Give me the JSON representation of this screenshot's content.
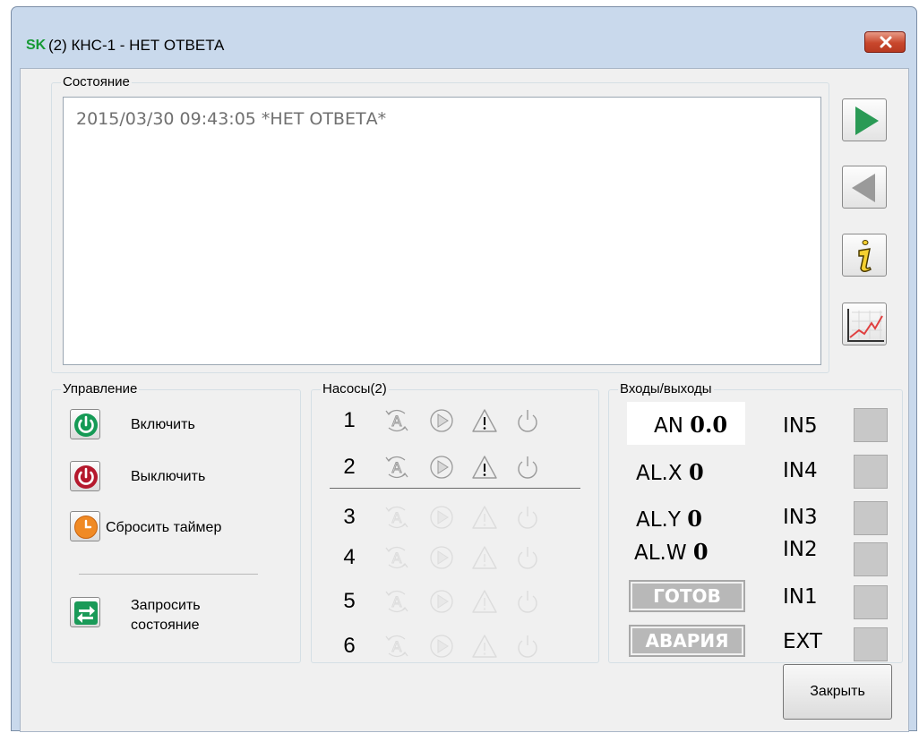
{
  "window": {
    "logo": "SK",
    "title": "(2) КНС-1 - НЕТ ОТВЕТА"
  },
  "status_group": {
    "legend": "Состояние",
    "log_line": "2015/03/30 09:43:05 *НЕТ ОТВЕТА*"
  },
  "side_buttons": [
    {
      "icon": "play-forward-icon",
      "color": "#2a9a55"
    },
    {
      "icon": "play-back-icon",
      "color": "#9a9a9a"
    },
    {
      "icon": "info-icon",
      "color": "#c8a000"
    },
    {
      "icon": "chart-icon",
      "color": "#e04040"
    }
  ],
  "control": {
    "legend": "Управление",
    "power_on": "Включить",
    "power_off": "Выключить",
    "reset_timer": "Сбросить таймер",
    "request_line1": "Запросить",
    "request_line2": "состояние"
  },
  "pumps": {
    "legend": "Насосы(2)",
    "rows": [
      {
        "num": "1",
        "active": true
      },
      {
        "num": "2",
        "active": true
      },
      {
        "num": "3",
        "active": false
      },
      {
        "num": "4",
        "active": false
      },
      {
        "num": "5",
        "active": false
      },
      {
        "num": "6",
        "active": false
      }
    ]
  },
  "io": {
    "legend": "Входы/выходы",
    "an_label": "AN",
    "an_value": "0.0",
    "alx_label": "AL.X",
    "alx_value": "0",
    "aly_label": "AL.Y",
    "aly_value": "0",
    "alw_label": "AL.W",
    "alw_value": "0",
    "ready": "ГОТОВ",
    "alarm": "АВАРИЯ",
    "inputs": [
      "IN5",
      "IN4",
      "IN3",
      "IN2",
      "IN1",
      "EXT"
    ]
  },
  "footer": {
    "close_label": "Закрыть"
  }
}
